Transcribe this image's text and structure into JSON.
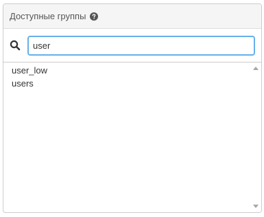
{
  "panel": {
    "title": "Доступные группы"
  },
  "search": {
    "value": "user"
  },
  "groups": {
    "items": [
      "user_low",
      "users"
    ]
  },
  "colors": {
    "accent": "#66afe9",
    "border": "#cccccc",
    "header_bg": "#f5f5f5",
    "text": "#333333"
  },
  "icons": {
    "help": "question-circle-icon",
    "search": "search-icon",
    "scroll_up": "triangle-up-icon",
    "scroll_down": "triangle-down-icon"
  }
}
